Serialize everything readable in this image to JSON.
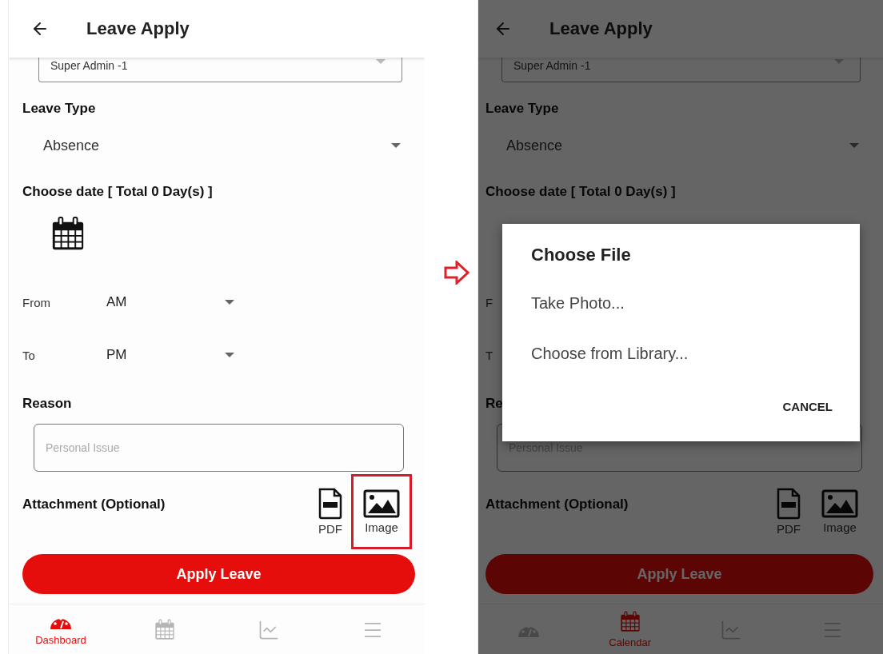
{
  "screens": [
    {
      "header": {
        "title": "Leave Apply"
      },
      "employee_select": {
        "value": "Super Admin -1"
      },
      "leave_type": {
        "label": "Leave Type",
        "value": "Absence"
      },
      "date": {
        "label": "Choose date [ Total 0 Day(s) ]",
        "calendar_visible": true
      },
      "from": {
        "label": "From",
        "value": "AM"
      },
      "to": {
        "label": "To",
        "value": "PM"
      },
      "reason": {
        "label": "Reason",
        "placeholder": "Personal Issue"
      },
      "attachment": {
        "label": "Attachment (Optional)",
        "options": [
          {
            "kind": "pdf",
            "label": "PDF",
            "highlighted": false
          },
          {
            "kind": "image",
            "label": "Image",
            "highlighted": true
          }
        ]
      },
      "apply_button": "Apply Leave",
      "nav": [
        {
          "kind": "dashboard",
          "label": "Dashboard",
          "selected": true
        },
        {
          "kind": "calendar",
          "selected": false
        },
        {
          "kind": "chart",
          "selected": false
        },
        {
          "kind": "menu",
          "selected": false
        }
      ]
    },
    {
      "header": {
        "title": "Leave Apply"
      },
      "employee_select": {
        "value": "Super Admin -1"
      },
      "leave_type": {
        "label": "Leave Type",
        "value": "Absence"
      },
      "date": {
        "label": "Choose date [ Total 0 Day(s) ]",
        "calendar_visible": false
      },
      "from": {
        "label": "F"
      },
      "to": {
        "label": "T"
      },
      "reason": {
        "label": "Re",
        "placeholder": "Personal Issue"
      },
      "attachment": {
        "label": "Attachment (Optional)",
        "options": [
          {
            "kind": "pdf",
            "label": "PDF",
            "highlighted": false
          },
          {
            "kind": "image",
            "label": "Image",
            "highlighted": false
          }
        ]
      },
      "apply_button": "Apply Leave",
      "nav": [
        {
          "kind": "dashboard",
          "selected": false
        },
        {
          "kind": "calendar",
          "label": "Calendar",
          "selected": true
        },
        {
          "kind": "chart",
          "selected": false
        },
        {
          "kind": "menu",
          "selected": false
        }
      ],
      "dialog": {
        "title": "Choose File",
        "options": [
          "Take Photo...",
          "Choose from Library..."
        ],
        "cancel": "CANCEL"
      }
    }
  ]
}
